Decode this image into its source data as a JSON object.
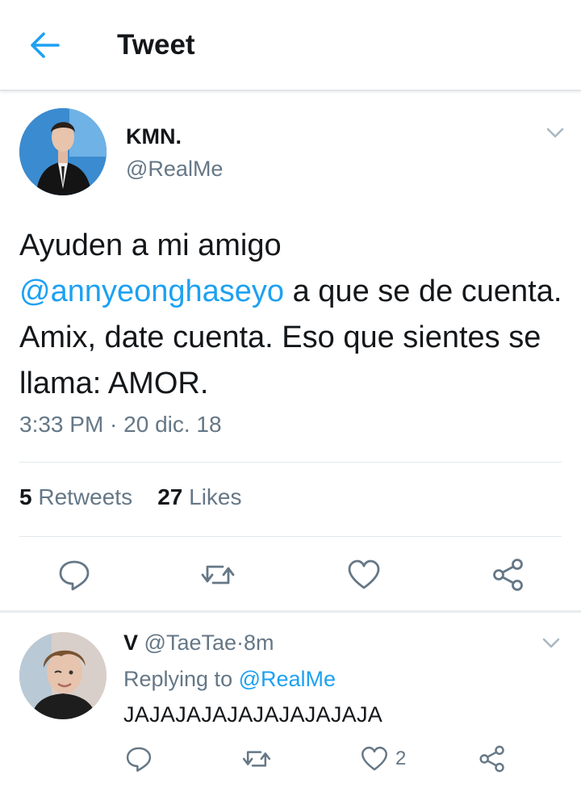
{
  "header": {
    "title": "Tweet",
    "back_icon": "back-arrow-icon"
  },
  "tweet": {
    "author_name": "KMN.",
    "author_handle": "@RealMe",
    "text_parts": {
      "line1": "Ayuden a mi amigo",
      "mention": "@annyeonghaseyo",
      "rest": " a que se de cuenta. Amix, date cuenta. Eso que sientes se llama: AMOR."
    },
    "timestamp": "3:33 PM · 20 dic. 18",
    "retweets_count": "5",
    "retweets_label": "Retweets",
    "likes_count": "27",
    "likes_label": "Likes",
    "actions": [
      "reply-icon",
      "retweet-icon",
      "like-icon",
      "share-icon"
    ]
  },
  "reply": {
    "author_name": "V",
    "author_handle": "@TaeTae",
    "separator": "·",
    "time": "8m",
    "replying_prefix": "Replying to",
    "replying_to": "@RealMe",
    "text": "JAJAJAJAJAJAJAJAJAJA",
    "like_count": "2"
  },
  "colors": {
    "accent": "#1da1f2",
    "secondary_text": "#657786",
    "divider": "#e1e8ed"
  }
}
